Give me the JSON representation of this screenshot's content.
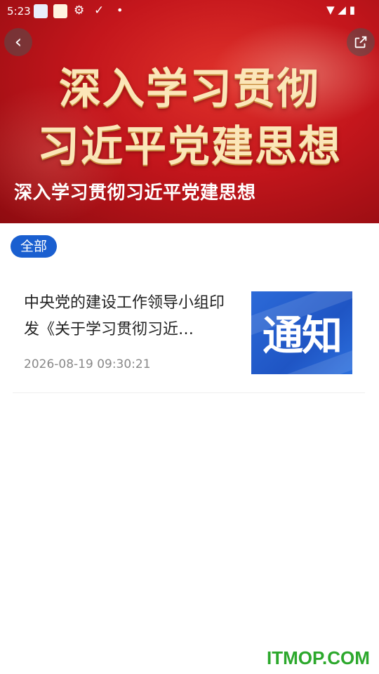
{
  "status_bar": {
    "time": "5:23"
  },
  "banner": {
    "title_line1": "深入学习贯彻",
    "title_line2": "习近平党建思想",
    "subtitle": "深入学习贯彻习近平党建思想"
  },
  "filter": {
    "selected_label": "全部"
  },
  "articles": [
    {
      "title": "中央党的建设工作领导小组印发《关于学习贯彻习近…",
      "date": "2026-08-19 09:30:21",
      "thumbnail_text": "通知"
    }
  ],
  "watermark": "ITMOP.COM",
  "colors": {
    "banner_red": "#c4161c",
    "chip_blue": "#1a5fd0",
    "watermark_green": "#2ca82c"
  }
}
